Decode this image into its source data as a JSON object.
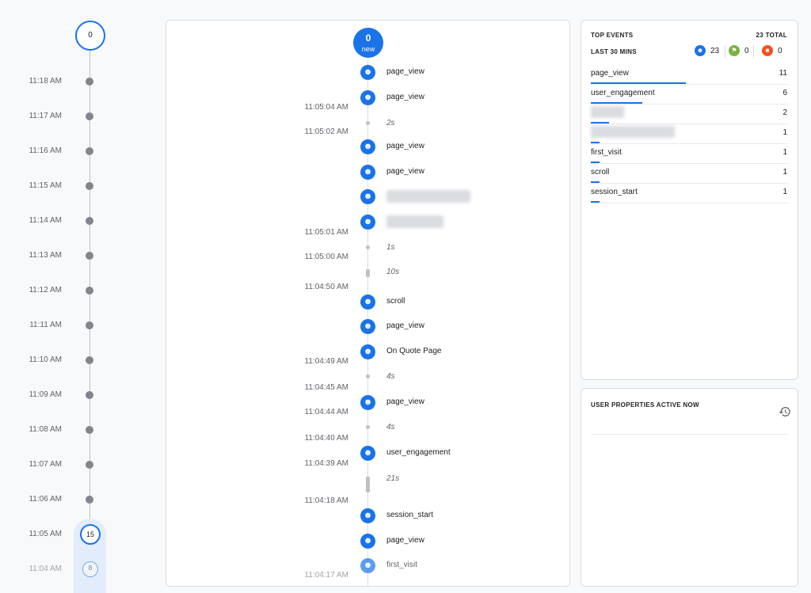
{
  "minutes": {
    "top_count": "0",
    "rows": [
      {
        "time": "11:18 AM"
      },
      {
        "time": "11:17 AM"
      },
      {
        "time": "11:16 AM"
      },
      {
        "time": "11:15 AM"
      },
      {
        "time": "11:14 AM"
      },
      {
        "time": "11:13 AM"
      },
      {
        "time": "11:12 AM"
      },
      {
        "time": "11:11 AM"
      },
      {
        "time": "11:10 AM"
      },
      {
        "time": "11:09 AM"
      },
      {
        "time": "11:08 AM"
      },
      {
        "time": "11:07 AM"
      },
      {
        "time": "11:06 AM"
      },
      {
        "time": "11:05 AM",
        "count": "15"
      },
      {
        "time": "11:04 AM",
        "count": "8"
      }
    ]
  },
  "stream": {
    "new_count": "0",
    "new_label": "new",
    "events": [
      {
        "name": "page_view"
      },
      {
        "name": "page_view"
      },
      {
        "name": "page_view"
      },
      {
        "name": "page_view"
      },
      {
        "name": ""
      },
      {
        "name": ""
      },
      {
        "name": "scroll"
      },
      {
        "name": "page_view"
      },
      {
        "name": "On Quote Page"
      },
      {
        "name": "page_view"
      },
      {
        "name": "user_engagement"
      },
      {
        "name": "session_start"
      },
      {
        "name": "page_view"
      },
      {
        "name": "first_visit"
      }
    ],
    "timestamps": [
      "11:05:04 AM",
      "11:05:02 AM",
      "11:05:01 AM",
      "11:05:00 AM",
      "11:04:50 AM",
      "11:04:49 AM",
      "11:04:45 AM",
      "11:04:44 AM",
      "11:04:40 AM",
      "11:04:39 AM",
      "11:04:18 AM",
      "11:04:17 AM"
    ],
    "gaps": [
      "2s",
      "1s",
      "10s",
      "4s",
      "4s",
      "21s"
    ]
  },
  "top_events": {
    "title": "TOP EVENTS",
    "total": "23 TOTAL",
    "period": "LAST 30 MINS",
    "counts": {
      "users": "23",
      "conversions": "0",
      "ecommerce": "0"
    },
    "colors": {
      "users": "#1a73e8",
      "conversions": "#7cb342",
      "ecommerce": "#f4511e"
    },
    "rows": [
      {
        "name": "page_view",
        "value": "11",
        "share": 0.48
      },
      {
        "name": "user_engagement",
        "value": "6",
        "share": 0.26
      },
      {
        "name": "",
        "value": "2",
        "share": 0.09
      },
      {
        "name": "",
        "value": "1",
        "share": 0.045
      },
      {
        "name": "first_visit",
        "value": "1",
        "share": 0.045
      },
      {
        "name": "scroll",
        "value": "1",
        "share": 0.045
      },
      {
        "name": "session_start",
        "value": "1",
        "share": 0.045
      }
    ]
  },
  "user_props": {
    "title": "USER PROPERTIES ACTIVE NOW"
  }
}
